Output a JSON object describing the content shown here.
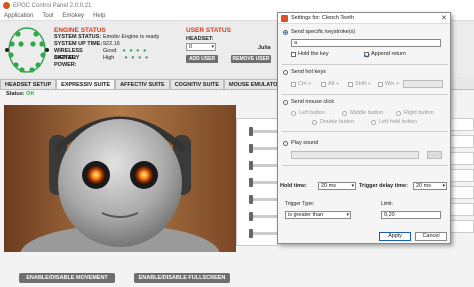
{
  "window": {
    "title": "EPOC Control Panel 2.0.0.21"
  },
  "menu": [
    "Application",
    "Tool",
    "Emokey",
    "Help"
  ],
  "engine_status": {
    "title": "ENGINE STATUS",
    "rows": [
      {
        "label": "SYSTEM STATUS:",
        "value": "Emotiv Engine is ready"
      },
      {
        "label": "SYSTEM UP TIME:",
        "value": "922.16"
      },
      {
        "label": "WIRELESS SIGNAL:",
        "value": "Good"
      },
      {
        "label": "BATTERY POWER:",
        "value": "High"
      }
    ],
    "signal_dots": "● ● ● ●",
    "battery_dots": "● ● ● ●"
  },
  "user_status": {
    "title": "USER STATUS",
    "headset_label": "HEADSET:",
    "headset_value": "0",
    "add_user": "ADD USER",
    "remove_user": "REMOVE USER",
    "user_name": "Julia"
  },
  "tabs": [
    "HEADSET SETUP",
    "EXPRESSIV SUITE",
    "AFFECTIV SUITE",
    "COGNITIV SUITE",
    "MOUSE EMULATO"
  ],
  "status_line": {
    "label": "Status:",
    "value": "OK"
  },
  "bottom_buttons": {
    "movement": "ENABLE/DISABLE MOVEMENT",
    "fullscreen": "ENABLE/DISABLE FULLSCREEN"
  },
  "dialog": {
    "title": "Settings for: Clench Teeth",
    "keystroke_label": "Send specific keystroke(s)",
    "keystroke_value": "a",
    "hold_key": "Hold the key",
    "append_return": "Append return",
    "hot_keys_label": "Send hot keys",
    "hot_keys": [
      "Ctrl +",
      "Alt +",
      "Shift +",
      "Win +"
    ],
    "mouse_label": "Send mouse click",
    "mouse_options": [
      "Left button",
      "Middle button",
      "Right button",
      "Double button",
      "Left hold button"
    ],
    "sound_label": "Play sound",
    "browse": "...",
    "hold_time_label": "Hold time:",
    "hold_time_value": "20 ms",
    "trigger_delay_label": "Trigger delay time:",
    "trigger_delay_value": "20 ms",
    "trigger_type_label": "Trigger Type:",
    "trigger_type_value": "is greater than",
    "limit_label": "Limit:",
    "limit_value": "0,20",
    "apply": "Apply",
    "cancel": "Cancel"
  },
  "colors": {
    "accent": "#d43a1a",
    "ok": "#2da84a",
    "button": "#6f6f6f"
  }
}
